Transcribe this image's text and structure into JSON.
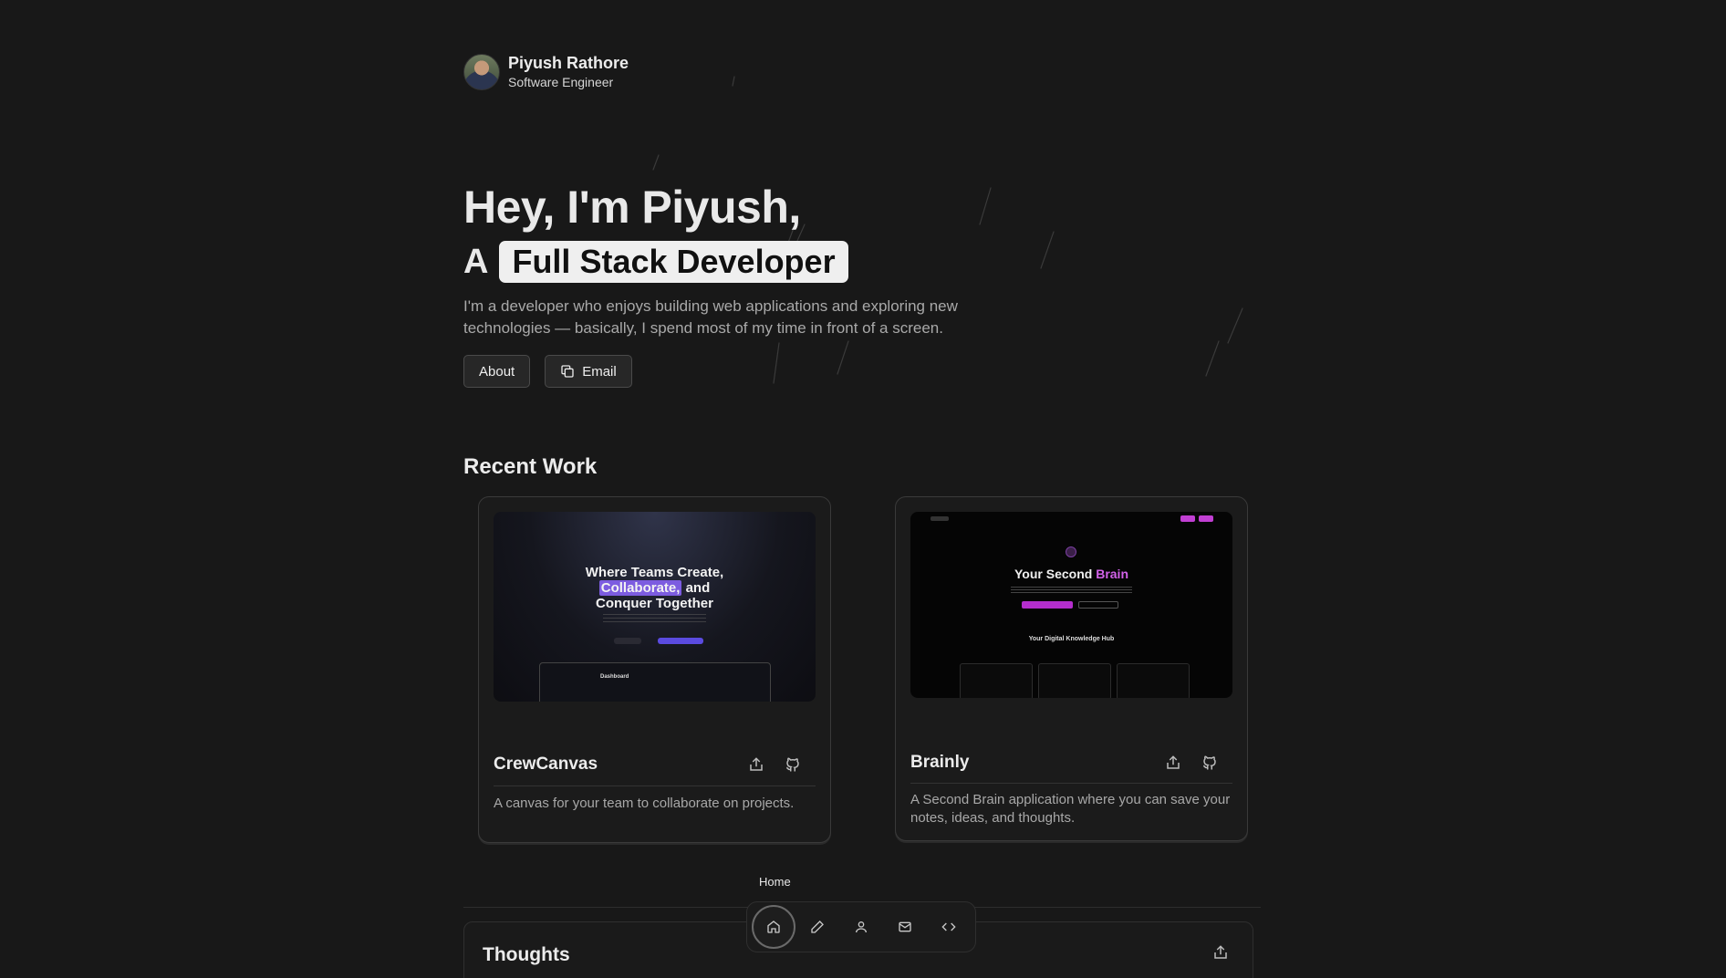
{
  "profile": {
    "name": "Piyush Rathore",
    "role": "Software Engineer"
  },
  "hero": {
    "greeting": "Hey, I'm Piyush,",
    "prefix": "A",
    "highlight": "Full Stack Developer",
    "description": "I'm a developer who enjoys building web applications and exploring new technologies — basically, I spend most of my time in front of a screen.",
    "buttons": {
      "about": "About",
      "email": "Email"
    }
  },
  "recent_work": {
    "title": "Recent Work",
    "projects": [
      {
        "title": "CrewCanvas",
        "description": "A canvas for your team to collaborate on projects.",
        "preview": {
          "line1": "Where Teams Create,",
          "highlight": "Collaborate,",
          "line2_rest": "and",
          "line3": "Conquer Together",
          "dashboard": "Dashboard"
        }
      },
      {
        "title": "Brainly",
        "description": "A Second Brain application where you can save your notes, ideas, and thoughts.",
        "preview": {
          "title_start": "Your Second",
          "title_accent": "Brain",
          "section": "Your Digital Knowledge Hub"
        }
      }
    ]
  },
  "thoughts": {
    "title": "Thoughts"
  },
  "dock": {
    "tooltip": "Home",
    "items": [
      "home-icon",
      "pencil-icon",
      "user-icon",
      "mail-icon",
      "code-icon"
    ]
  },
  "colors": {
    "background": "#181818",
    "highlight_bg": "#efefef",
    "brainly_accent": "#d262e8",
    "crewcanvas_accent": "#7c5ce0"
  }
}
